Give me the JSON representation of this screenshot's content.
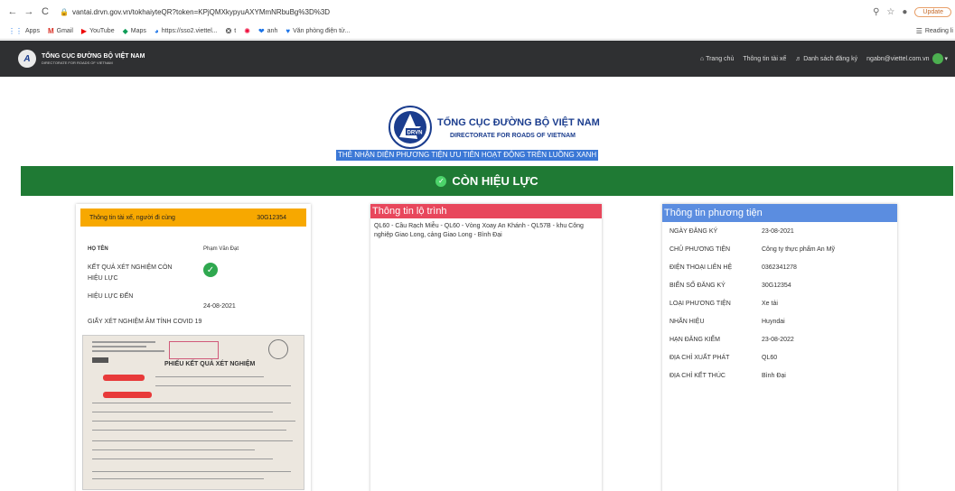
{
  "browser": {
    "url": "vantai.drvn.gov.vn/tokhaiyteQR?token=KPjQMXkypyuAXYMmNRbuBg%3D%3D",
    "update_label": "Update",
    "bookmarks": [
      "Apps",
      "Gmail",
      "YouTube",
      "Maps",
      "https://sso2.viettel...",
      "t",
      "anh",
      "Văn phòng điện tử..."
    ],
    "reading_list": "Reading li"
  },
  "site": {
    "brand_line1": "TỔNG CỤC ĐƯỜNG BỘ VIỆT NAM",
    "brand_line2": "DIRECTORATE FOR ROADS OF VIETNAM",
    "nav": {
      "home": "Trang chủ",
      "driver_info": "Thông tin tài xế",
      "register_list": "Danh sách đăng ký",
      "user_email": "ngabn@viettel.com.vn"
    }
  },
  "hero": {
    "logo_text": "DRVN",
    "title1": "TỔNG CỤC ĐƯỜNG BỘ VIỆT NAM",
    "title2": "DIRECTORATE FOR ROADS OF VIETNAM",
    "subtitle": "THẺ NHẬN DIỆN PHƯƠNG TIỆN ƯU TIÊN HOẠT ĐỘNG TRÊN LUỒNG XANH",
    "status": "CÒN HIỆU LỰC"
  },
  "driver_card": {
    "header_label": "Thông tin tài xế, người đi cùng",
    "plate": "30G12354",
    "name_label": "HỌ TÊN",
    "name_value": "Phạm Văn Đạt",
    "test_result_label": "KẾT QUẢ XÉT NGHIỆM CÒN HIỆU LỰC",
    "valid_until_label": "HIỆU LỰC ĐẾN",
    "valid_until_value": "24-08-2021",
    "certificate_label": "GIẤY XÉT NGHIỆM ÂM TÍNH COVID 19",
    "doc_title": "PHIẾU KẾT QUẢ XÉT NGHIỆM"
  },
  "route_card": {
    "header": "Thông tin lộ trình",
    "body": "QL60 - Cầu Rạch Miễu - QL60 - Vòng Xoay An Khánh - QL57B - khu Công nghiệp Giao Long, cảng Giao Long - Bình Đại"
  },
  "vehicle_card": {
    "header": "Thông tin phương tiện",
    "rows": [
      {
        "label": "NGÀY ĐĂNG KÝ",
        "value": "23-08-2021"
      },
      {
        "label": "CHỦ PHƯƠNG TIỆN",
        "value": "Công ty thực phẩm An Mỹ"
      },
      {
        "label": "ĐIỆN THOẠI LIÊN HỆ",
        "value": "0362341278"
      },
      {
        "label": "BIỂN SỐ ĐĂNG KÝ",
        "value": "30G12354"
      },
      {
        "label": "LOẠI PHƯƠNG TIỆN",
        "value": "Xe tải"
      },
      {
        "label": "NHÃN HIỆU",
        "value": "Huyndai"
      },
      {
        "label": "HẠN ĐĂNG KIỂM",
        "value": "23-08-2022"
      },
      {
        "label": "ĐỊA CHỈ XUẤT PHÁT",
        "value": "QL60"
      },
      {
        "label": "ĐỊA CHỈ KẾT THÚC",
        "value": "Bình Đại"
      }
    ]
  },
  "colors": {
    "header_bg": "#2f3032",
    "status_green": "#1f7a34",
    "driver_orange": "#f7a800",
    "route_red": "#e8475c",
    "vehicle_blue": "#5b8de0",
    "brand_blue": "#1b3d8e"
  }
}
